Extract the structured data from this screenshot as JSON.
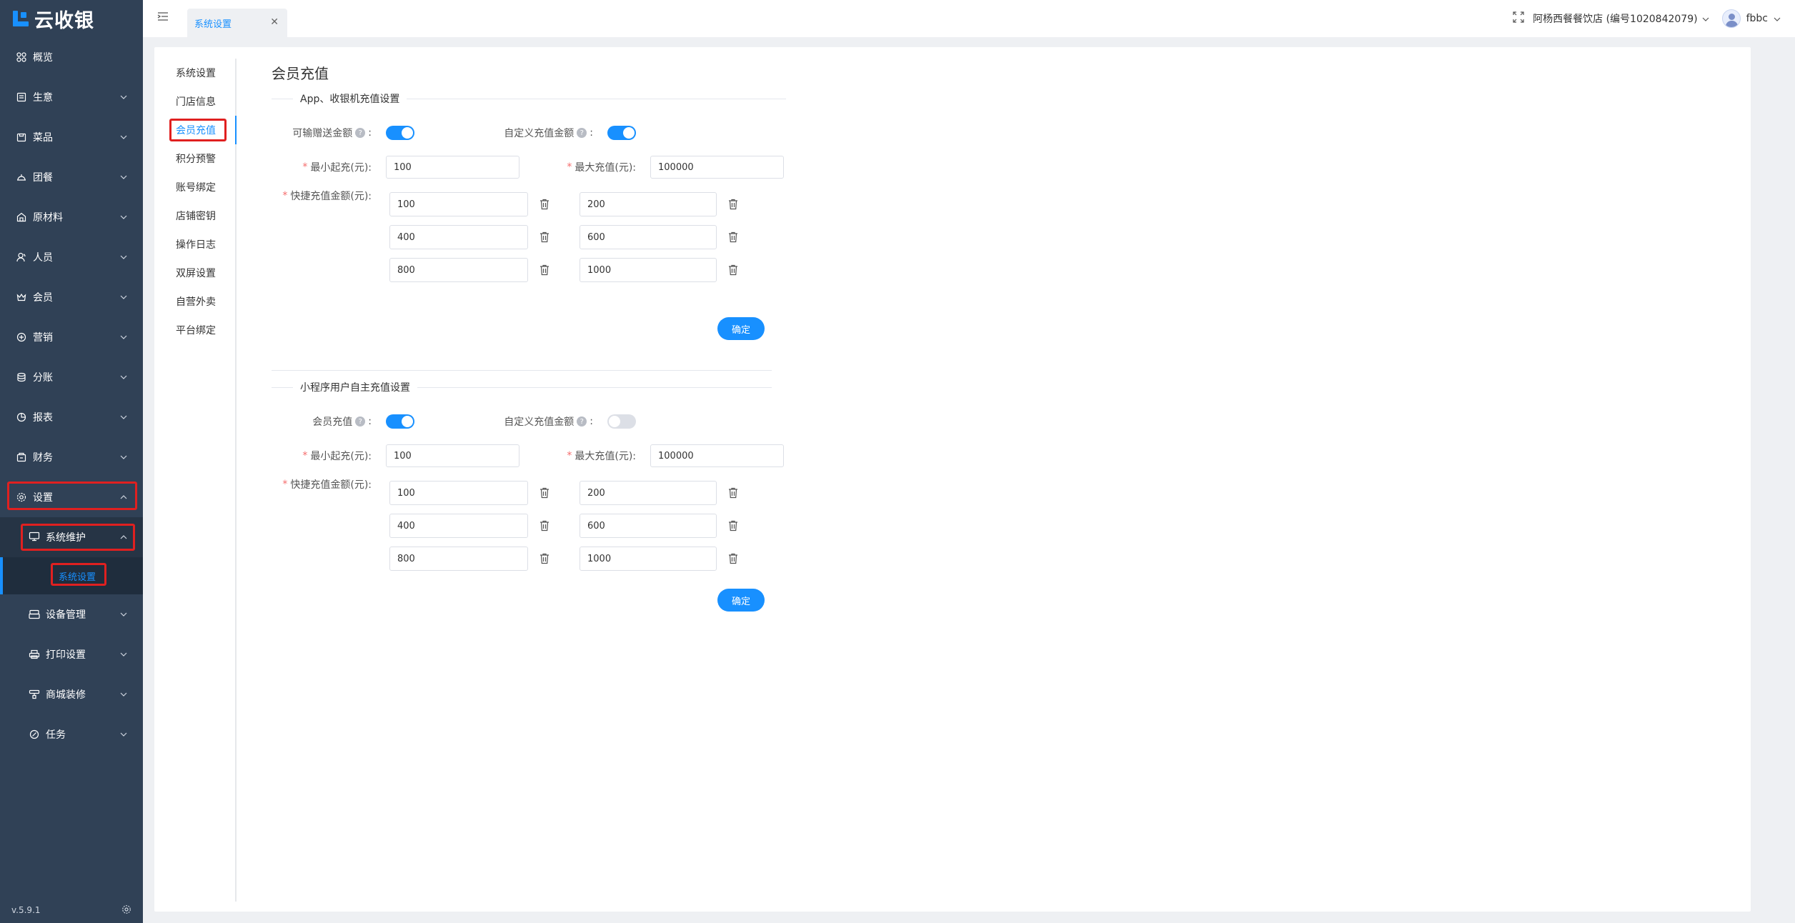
{
  "app": {
    "logo_text": "云收银",
    "version": "v.5.9.1"
  },
  "sidebar": {
    "items": [
      {
        "label": "概览",
        "icon": "dashboard-icon",
        "has_arrow": false
      },
      {
        "label": "生意",
        "icon": "business-icon",
        "has_arrow": true
      },
      {
        "label": "菜品",
        "icon": "dish-icon",
        "has_arrow": true
      },
      {
        "label": "团餐",
        "icon": "group-meal-icon",
        "has_arrow": true
      },
      {
        "label": "原材料",
        "icon": "material-icon",
        "has_arrow": true
      },
      {
        "label": "人员",
        "icon": "staff-icon",
        "has_arrow": true
      },
      {
        "label": "会员",
        "icon": "member-icon",
        "has_arrow": true
      },
      {
        "label": "营销",
        "icon": "marketing-icon",
        "has_arrow": true
      },
      {
        "label": "分账",
        "icon": "split-icon",
        "has_arrow": true
      },
      {
        "label": "报表",
        "icon": "report-icon",
        "has_arrow": true
      },
      {
        "label": "财务",
        "icon": "finance-icon",
        "has_arrow": true
      }
    ],
    "settings": {
      "label": "设置",
      "sub": {
        "label": "系统维护",
        "child": "系统设置"
      },
      "others": [
        {
          "label": "设备管理",
          "icon": "device-icon"
        },
        {
          "label": "打印设置",
          "icon": "printer-icon"
        },
        {
          "label": "商城装修",
          "icon": "decorate-icon"
        },
        {
          "label": "任务",
          "icon": "task-icon"
        }
      ]
    }
  },
  "header": {
    "tab_label": "系统设置",
    "store": "阿杨西餐餐饮店 (编号1020842079)",
    "user": "fbbc"
  },
  "subnav": [
    "系统设置",
    "门店信息",
    "会员充值",
    "积分预警",
    "账号绑定",
    "店铺密钥",
    "操作日志",
    "双屏设置",
    "自营外卖",
    "平台绑定"
  ],
  "subnav_active": 2,
  "content": {
    "title": "会员充值",
    "section1": {
      "title": "App、收银机充值设置",
      "switch1_label": "可输赠送金额",
      "switch1_on": true,
      "switch2_label": "自定义充值金额",
      "switch2_on": true,
      "min_label": "最小起充(元):",
      "min_value": "100",
      "max_label": "最大充值(元):",
      "max_value": "100000",
      "quick_label": "快捷充值金额(元):",
      "quick": [
        [
          "100",
          "200"
        ],
        [
          "400",
          "600"
        ],
        [
          "800",
          "1000"
        ]
      ],
      "confirm": "确定"
    },
    "section2": {
      "title": "小程序用户自主充值设置",
      "switch1_label": "会员充值",
      "switch1_on": true,
      "switch2_label": "自定义充值金额",
      "switch2_on": false,
      "min_label": "最小起充(元):",
      "min_value": "100",
      "max_label": "最大充值(元):",
      "max_value": "100000",
      "quick_label": "快捷充值金额(元):",
      "quick": [
        [
          "100",
          "200"
        ],
        [
          "400",
          "600"
        ],
        [
          "800",
          "1000"
        ]
      ],
      "confirm": "确定"
    }
  },
  "colors": {
    "sidebar_bg": "#304156",
    "accent": "#1890ff",
    "highlight": "#e02020"
  }
}
